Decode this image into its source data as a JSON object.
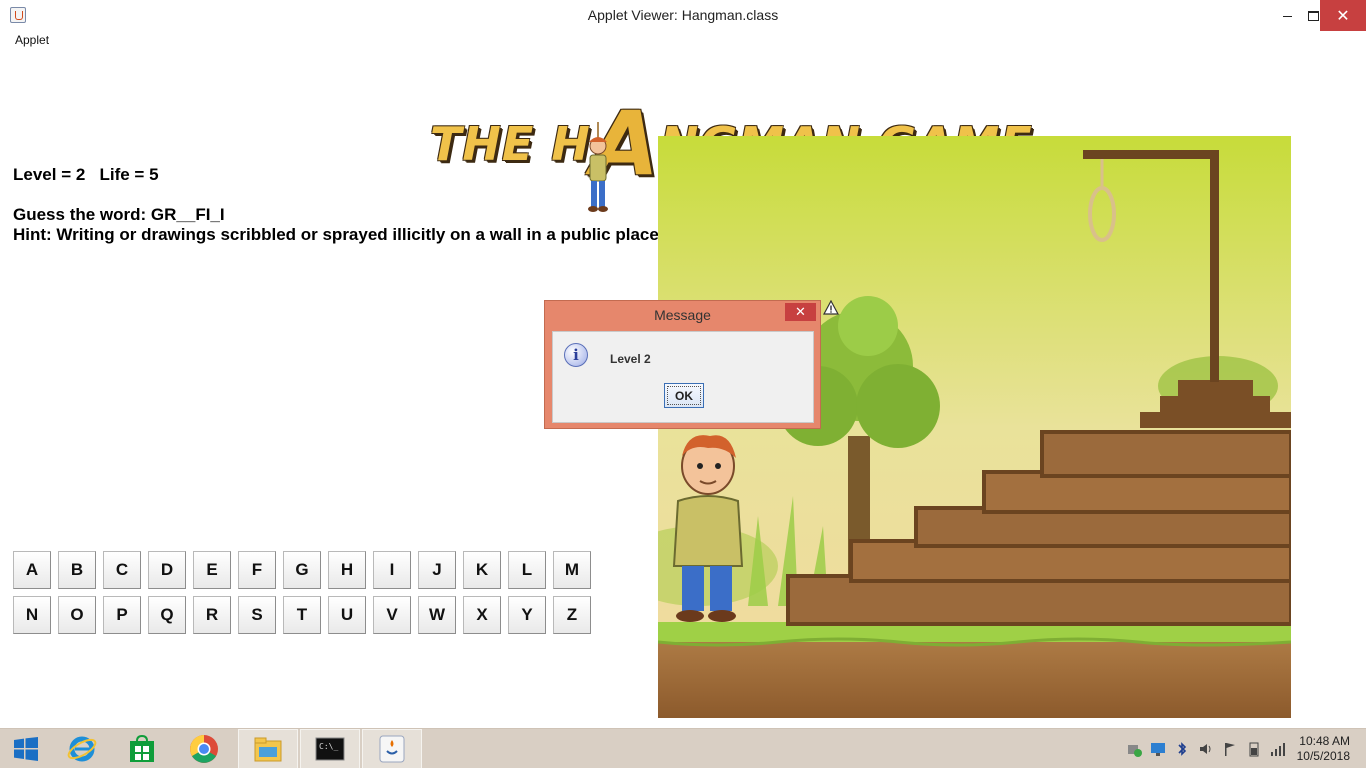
{
  "window": {
    "title": "Applet Viewer: Hangman.class",
    "close_glyph": "✕"
  },
  "menu": {
    "applet": "Applet"
  },
  "game": {
    "title_part1": "THE H",
    "title_big_letter": "A",
    "title_part2": "NGMAN GAME",
    "status": "Level = 2   Life = 5",
    "guess": "Guess the word: GR__FI_I",
    "hint": "Hint: Writing or drawings scribbled or sprayed illicitly on a wall in a public place."
  },
  "keyboard": {
    "row1": [
      "A",
      "B",
      "C",
      "D",
      "E",
      "F",
      "G",
      "H",
      "I",
      "J",
      "K",
      "L",
      "M"
    ],
    "row2": [
      "N",
      "O",
      "P",
      "Q",
      "R",
      "S",
      "T",
      "U",
      "V",
      "W",
      "X",
      "Y",
      "Z"
    ]
  },
  "dialog": {
    "title": "Message",
    "close_glyph": "✕",
    "icon_glyph": "i",
    "message": "Level 2",
    "ok_label": "OK"
  },
  "taskbar": {
    "items": [
      {
        "name": "start-icon"
      },
      {
        "name": "internet-explorer-icon"
      },
      {
        "name": "store-icon"
      },
      {
        "name": "chrome-icon"
      },
      {
        "name": "file-explorer-icon"
      },
      {
        "name": "command-prompt-icon"
      },
      {
        "name": "java-icon"
      }
    ],
    "cmd_glyph": "C:\\_",
    "time": "10:48 AM",
    "date": "10/5/2018"
  },
  "colors": {
    "close_red": "#c74040",
    "dialog_frame": "#e6876c",
    "taskbar": "#d9cfc4",
    "title_gold": "#f0c24a",
    "wood": "#6b4420"
  }
}
